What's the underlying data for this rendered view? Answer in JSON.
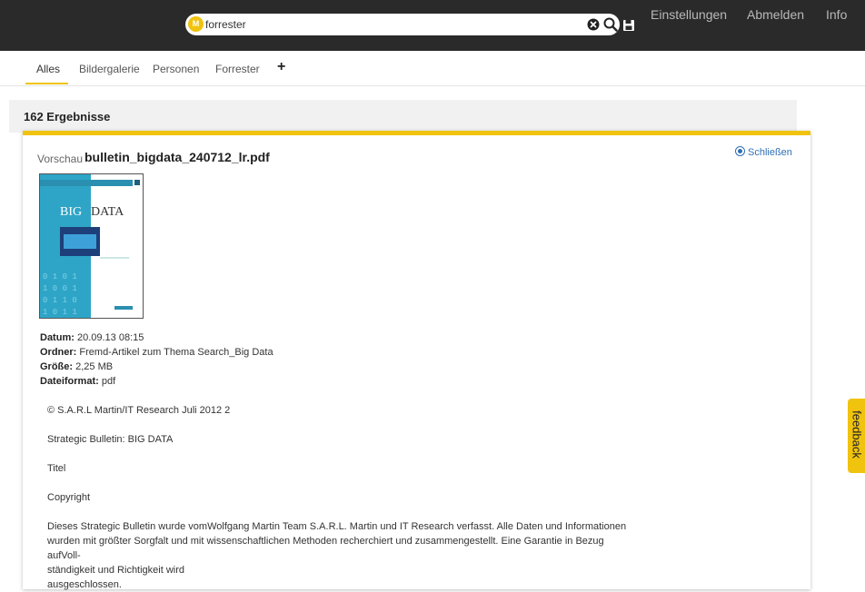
{
  "search": {
    "value": "forrester",
    "logo_text": "M"
  },
  "topnav": {
    "settings": "Einstellungen",
    "logout": "Abmelden",
    "info": "Info"
  },
  "tabs": [
    {
      "label": "Alles"
    },
    {
      "label": "Bildergalerie"
    },
    {
      "label": "Personen"
    },
    {
      "label": "Forrester"
    }
  ],
  "tabs_add": "+",
  "results": {
    "count_label": "162 Ergebnisse"
  },
  "preview": {
    "label": "Vorschau",
    "filename": "bulletin_bigdata_240712_lr.pdf",
    "close_label": "Schließen",
    "thumbnail_title_1": "BIG",
    "thumbnail_title_2": "DATA",
    "meta": {
      "date_label": "Datum:",
      "date": "20.09.13 08:15",
      "folder_label": "Ordner:",
      "folder": "Fremd-Artikel zum Thema Search_Big Data",
      "size_label": "Größe:",
      "size": "2,25 MB",
      "format_label": "Dateiformat:",
      "format": "pdf"
    },
    "text": {
      "p1": "© S.A.R.L Martin/IT Research Juli 2012 2",
      "p2": "Strategic Bulletin: BIG DATA",
      "p3": "Titel",
      "p4": "Copyright",
      "p5_1": "Dieses Strategic Bulletin wurde vomWolfgang Martin Team S.A.R.L. Martin und IT Research verfasst. Alle Daten und Informationen",
      "p5_2": "wurden mit größter Sorgfalt und mit wissenschaftlichen Methoden recherchiert und zusammengestellt. Eine Garantie in Bezug aufVoll-",
      "p5_3": "ständigkeit und Richtigkeit wird",
      "p5_4": "ausgeschlossen."
    }
  },
  "feedback": {
    "label": "feedback"
  },
  "colors": {
    "accent": "#f0c30f",
    "topbar": "#2a2a2a",
    "link": "#2f6fb5"
  },
  "icons": {
    "clear": "clear-circle-icon",
    "search": "search-icon",
    "save": "save-icon",
    "close": "close-circle-icon"
  }
}
